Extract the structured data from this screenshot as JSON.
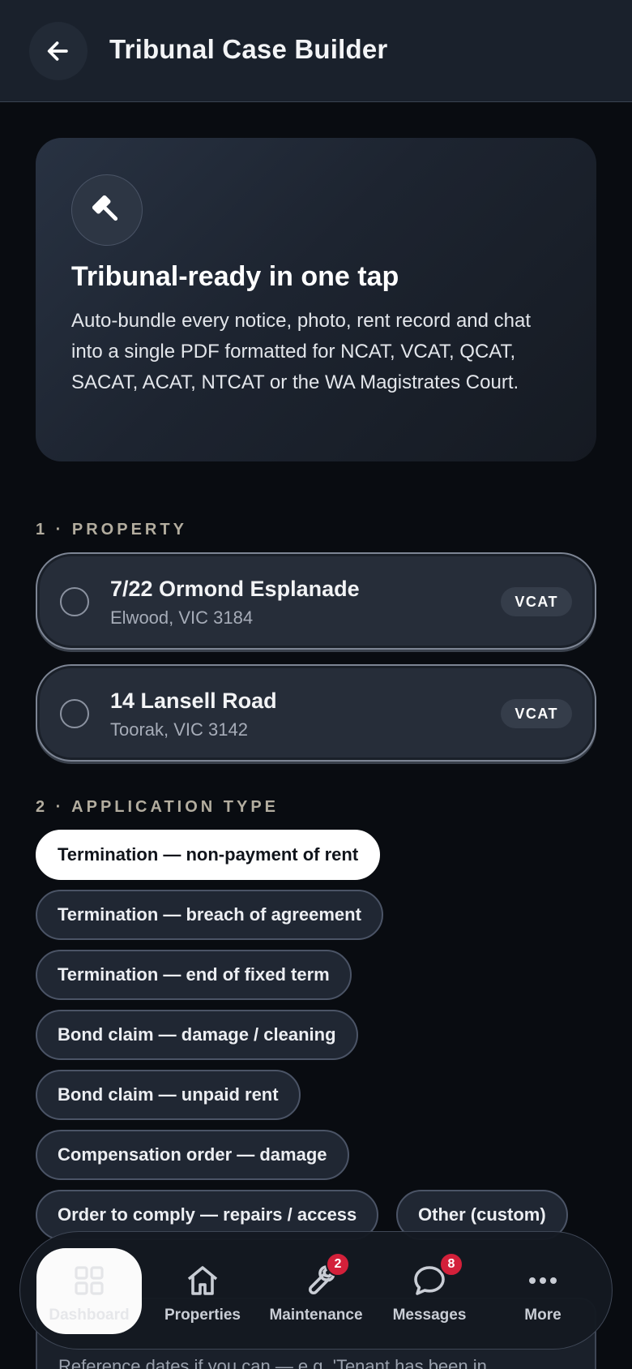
{
  "header": {
    "title": "Tribunal Case Builder",
    "back_icon": "arrow-left-icon"
  },
  "hero": {
    "icon": "gavel-icon",
    "title": "Tribunal-ready in one tap",
    "body": "Auto-bundle every notice, photo, rent record and chat into a single PDF formatted for NCAT, VCAT, QCAT, SACAT, ACAT, NTCAT or the WA Magistrates Court."
  },
  "property_section": {
    "label": "1 · PROPERTY",
    "properties": [
      {
        "name": "7/22 Ormond Esplanade",
        "suburb": "Elwood, VIC 3184",
        "tribunal": "VCAT",
        "selected": false
      },
      {
        "name": "14 Lansell Road",
        "suburb": "Toorak, VIC 3142",
        "tribunal": "VCAT",
        "selected": false
      }
    ]
  },
  "application_section": {
    "label": "2 · APPLICATION TYPE",
    "selected_index": 0,
    "options": [
      "Termination — non-payment of rent",
      "Termination — breach of agreement",
      "Termination — end of fixed term",
      "Bond claim — damage / cleaning",
      "Bond claim — unpaid rent",
      "Compensation order — damage",
      "Order to comply — repairs / access",
      "Other (custom)"
    ]
  },
  "notes": {
    "visible_text": "Reference dates if you can — e.g. 'Tenant has been in"
  },
  "bottom_nav": {
    "items": [
      {
        "label": "Dashboard",
        "icon": "grid-icon",
        "active": true,
        "badge": ""
      },
      {
        "label": "Properties",
        "icon": "home-icon",
        "active": false,
        "badge": ""
      },
      {
        "label": "Maintenance",
        "icon": "wrench-icon",
        "active": false,
        "badge": "2"
      },
      {
        "label": "Messages",
        "icon": "chat-bubble-icon",
        "active": false,
        "badge": "8"
      },
      {
        "label": "More",
        "icon": "more-dots-icon",
        "active": false,
        "badge": ""
      }
    ]
  },
  "colors": {
    "background": "#090c11",
    "header": "#1a212c",
    "badge_red": "#d3203a",
    "selected_chip": "#ffffff",
    "section_label": "#b3ad9f"
  }
}
